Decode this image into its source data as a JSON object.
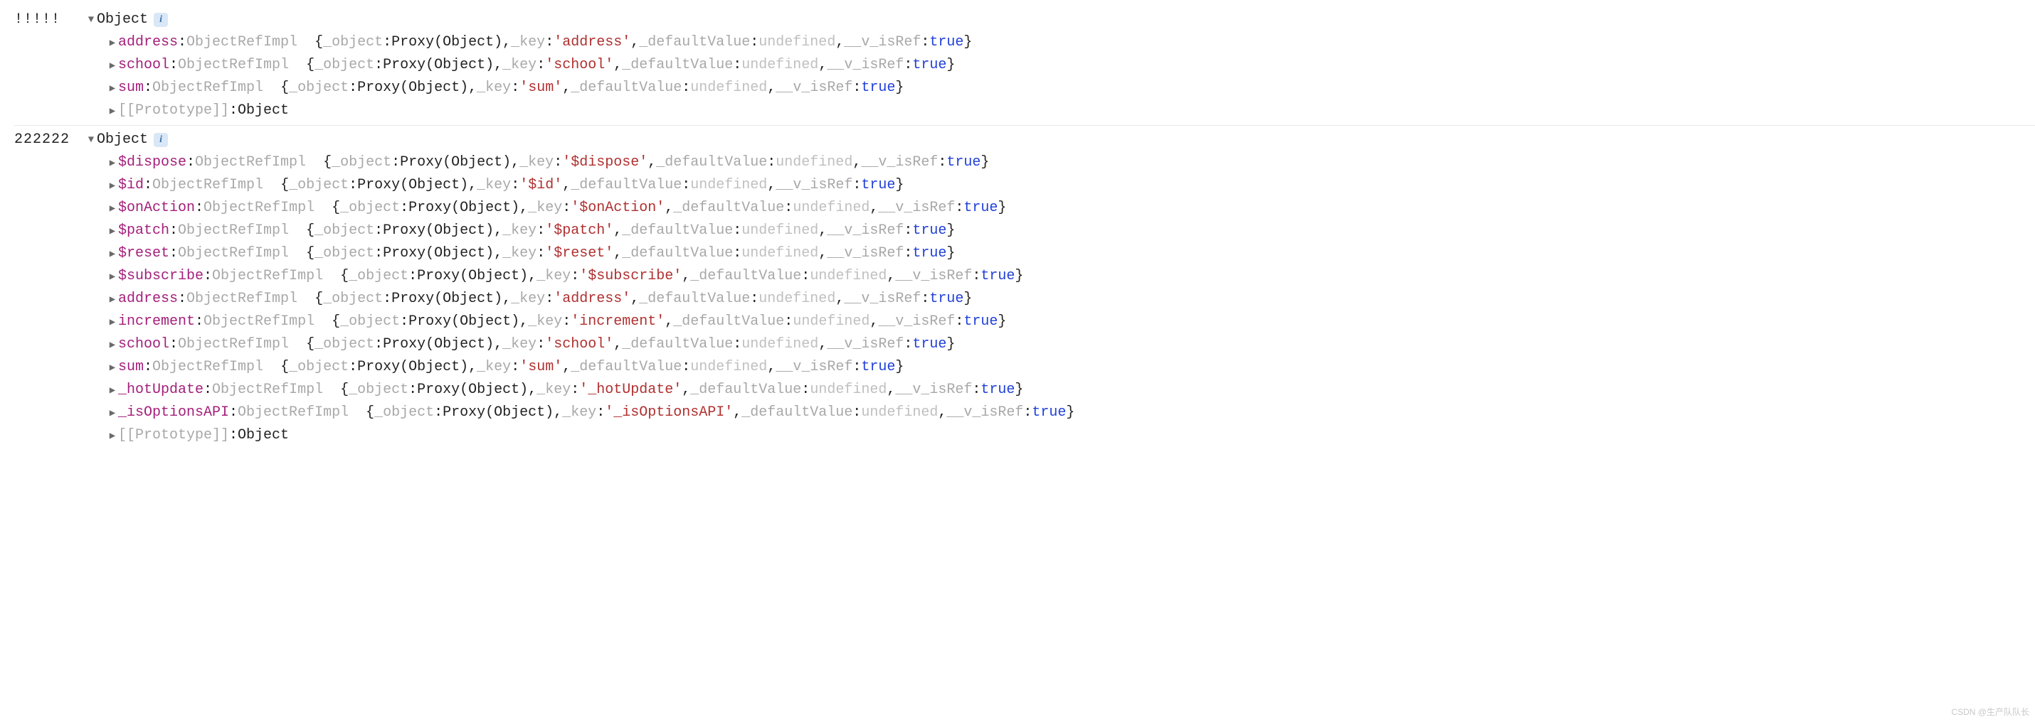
{
  "info_badge": "i",
  "object_label": "Object",
  "prototype_label": "[[Prototype]]",
  "prototype_value": "Object",
  "ref_class": "ObjectRefImpl",
  "field_object": "_object",
  "field_key": "_key",
  "field_default": "_defaultValue",
  "field_isref": "__v_isRef",
  "val_proxy": "Proxy(Object)",
  "val_undefined": "undefined",
  "val_true": "true",
  "entries": [
    {
      "prefix": "!!!!!",
      "props": [
        {
          "name": "address",
          "key": "'address'"
        },
        {
          "name": "school",
          "key": "'school'"
        },
        {
          "name": "sum",
          "key": "'sum'"
        }
      ]
    },
    {
      "prefix": "222222",
      "props": [
        {
          "name": "$dispose",
          "key": "'$dispose'"
        },
        {
          "name": "$id",
          "key": "'$id'"
        },
        {
          "name": "$onAction",
          "key": "'$onAction'"
        },
        {
          "name": "$patch",
          "key": "'$patch'"
        },
        {
          "name": "$reset",
          "key": "'$reset'"
        },
        {
          "name": "$subscribe",
          "key": "'$subscribe'"
        },
        {
          "name": "address",
          "key": "'address'"
        },
        {
          "name": "increment",
          "key": "'increment'"
        },
        {
          "name": "school",
          "key": "'school'"
        },
        {
          "name": "sum",
          "key": "'sum'"
        },
        {
          "name": "_hotUpdate",
          "key": "'_hotUpdate'"
        },
        {
          "name": "_isOptionsAPI",
          "key": "'_isOptionsAPI'"
        }
      ]
    }
  ],
  "watermark": "CSDN @生产队队长"
}
